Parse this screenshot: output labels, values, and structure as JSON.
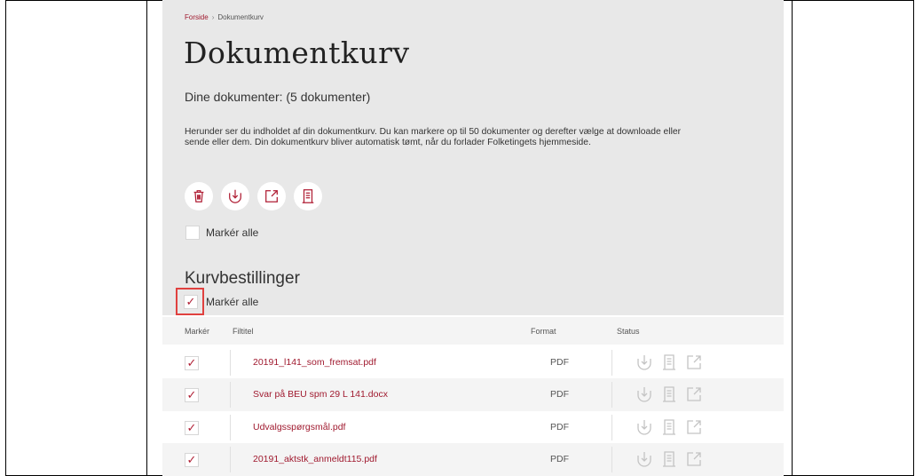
{
  "breadcrumb": {
    "home": "Forside",
    "separator": "›",
    "current": "Dokumentkurv"
  },
  "page": {
    "title": "Dokumentkurv",
    "subtitle": "Dine dokumenter: (5 dokumenter)",
    "description_line1": "Herunder ser du indholdet af din dokumentkurv. Du kan markere op til 50 dokumenter og derefter vælge at downloade eller",
    "description_line2": "sende eller dem. Din dokumentkurv bliver automatisk tømt, når du forlader Folketingets hjemmeside."
  },
  "actions": [
    {
      "icon": "trash-icon"
    },
    {
      "icon": "download-icon"
    },
    {
      "icon": "share-icon"
    },
    {
      "icon": "document-icon"
    }
  ],
  "select_all_docs": {
    "label": "Markér alle",
    "checked": false
  },
  "orders": {
    "heading": "Kurvbestillinger",
    "select_all_label": "Markér alle",
    "select_all_checked": true,
    "check_glyph": "✓",
    "columns": {
      "mark": "Markér",
      "title": "Filtitel",
      "format": "Format",
      "status": "Status"
    },
    "rows": [
      {
        "checked": true,
        "file": "20191_l141_som_fremsat.pdf",
        "format": "PDF"
      },
      {
        "checked": true,
        "file": "Svar på BEU spm 29 L 141.docx",
        "format": "PDF"
      },
      {
        "checked": true,
        "file": "Udvalgsspørgsmål.pdf",
        "format": "PDF"
      },
      {
        "checked": true,
        "file": "20191_aktstk_anmeldt115.pdf",
        "format": "PDF"
      }
    ]
  },
  "colors": {
    "accent": "#a01a2f",
    "panel": "#e8e8e8",
    "highlight": "#e0413f"
  }
}
